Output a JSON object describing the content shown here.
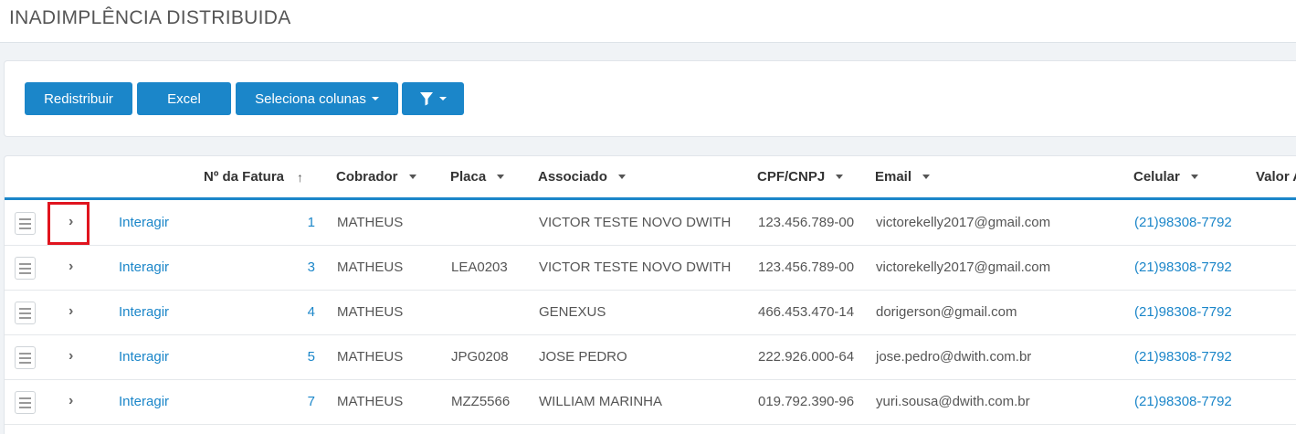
{
  "page": {
    "title": "INADIMPLÊNCIA DISTRIBUIDA"
  },
  "toolbar": {
    "redistribuir_label": "Redistribuir",
    "excel_label": "Excel",
    "seleciona_colunas_label": "Seleciona colunas",
    "filter_icon": "filter-icon"
  },
  "table": {
    "headers": {
      "fatura": "Nº da Fatura",
      "fatura_sort": "↑",
      "cobrador": "Cobrador",
      "placa": "Placa",
      "associado": "Associado",
      "cpf": "CPF/CNPJ",
      "email": "Email",
      "celular": "Celular",
      "valor": "Valor A"
    },
    "rows": [
      {
        "action": "Interagir",
        "fatura": "1",
        "cobrador": "MATHEUS",
        "placa": "",
        "associado": "VICTOR TESTE NOVO DWITH",
        "cpf": "123.456.789-00",
        "email": "victorekelly2017@gmail.com",
        "celular": "(21)98308-7792"
      },
      {
        "action": "Interagir",
        "fatura": "3",
        "cobrador": "MATHEUS",
        "placa": "LEA0203",
        "associado": "VICTOR TESTE NOVO DWITH",
        "cpf": "123.456.789-00",
        "email": "victorekelly2017@gmail.com",
        "celular": "(21)98308-7792"
      },
      {
        "action": "Interagir",
        "fatura": "4",
        "cobrador": "MATHEUS",
        "placa": "",
        "associado": "GENEXUS",
        "cpf": "466.453.470-14",
        "email": "dorigerson@gmail.com",
        "celular": "(21)98308-7792"
      },
      {
        "action": "Interagir",
        "fatura": "5",
        "cobrador": "MATHEUS",
        "placa": "JPG0208",
        "associado": "JOSE PEDRO",
        "cpf": "222.926.000-64",
        "email": "jose.pedro@dwith.com.br",
        "celular": "(21)98308-7792"
      },
      {
        "action": "Interagir",
        "fatura": "7",
        "cobrador": "MATHEUS",
        "placa": "MZZ5566",
        "associado": "WILLIAM MARINHA",
        "cpf": "019.792.390-96",
        "email": "yuri.sousa@dwith.com.br",
        "celular": "(21)98308-7792"
      }
    ]
  },
  "colors": {
    "accent": "#1b86c9",
    "highlight": "#e0141e"
  }
}
